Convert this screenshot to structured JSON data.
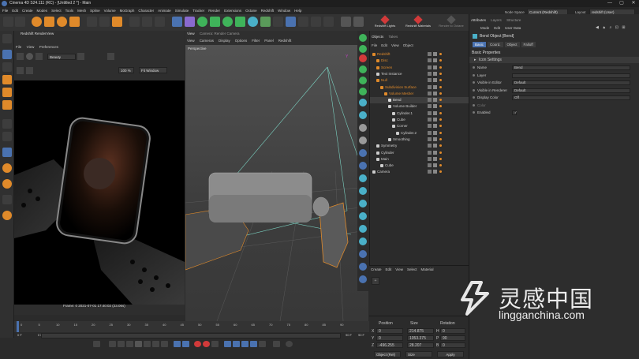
{
  "window": {
    "title": "Cinema 4D S24.111 (RC) - [Untitled 2 *] - Main",
    "controls": [
      "—",
      "▢",
      "✕"
    ]
  },
  "menubar": [
    "File",
    "Edit",
    "Create",
    "Modes",
    "Select",
    "Tools",
    "Mesh",
    "Spline",
    "Volume",
    "MoGraph",
    "Character",
    "Animate",
    "Simulate",
    "Tracker",
    "Render",
    "Extensions",
    "Octane",
    "Redshift",
    "Window",
    "Help"
  ],
  "toolbar": {
    "redshift_lights": "Redshift Lights",
    "redshift_materials": "Redshift Materials",
    "octane_label": "Render to Octane",
    "node_space_label": "Node Space",
    "node_space_value": "Current (Redshift)",
    "layout_label": "Layout",
    "layout_value": "redshift (User)"
  },
  "render_view": {
    "title": "Redshift RenderView",
    "menu": [
      "File",
      "View",
      "Preferences"
    ],
    "mode_select": "Beauty",
    "zoom": "100 %",
    "display": "Fit Window",
    "status": "Frame: 0  2021-07-01  17:40:02  (23.06s)"
  },
  "viewport": {
    "tab1": "View",
    "tab2": "Camera: Render Camera",
    "menu": [
      "View",
      "Cameras",
      "Display",
      "Options",
      "Filter",
      "Panel",
      "Redshift"
    ],
    "label": "Perspective"
  },
  "objects": {
    "tabs": [
      "Objects",
      "Takes"
    ],
    "menu": [
      "File",
      "Edit",
      "View",
      "Object"
    ],
    "items": [
      {
        "name": "Redshift",
        "indent": 0,
        "color": "#e08a2a"
      },
      {
        "name": "Disc",
        "indent": 1,
        "color": "#e08a2a"
      },
      {
        "name": "Screen",
        "indent": 1,
        "color": "#e08a2a"
      },
      {
        "name": "Text Instance",
        "indent": 1,
        "color": "#ccc"
      },
      {
        "name": "Null",
        "indent": 1,
        "color": "#e08a2a"
      },
      {
        "name": "Subdivision Surface",
        "indent": 2,
        "color": "#e08a2a"
      },
      {
        "name": "Volume Mesher",
        "indent": 3,
        "color": "#e08a2a"
      },
      {
        "name": "Bend",
        "indent": 4,
        "color": "#ddd"
      },
      {
        "name": "Volume Builder",
        "indent": 4,
        "color": "#ccc"
      },
      {
        "name": "Cylinder.1",
        "indent": 5,
        "color": "#ccc"
      },
      {
        "name": "Cube",
        "indent": 5,
        "color": "#ccc"
      },
      {
        "name": "Corner",
        "indent": 5,
        "color": "#ccc"
      },
      {
        "name": "Cylinder.2",
        "indent": 6,
        "color": "#ccc"
      },
      {
        "name": "Smoothing",
        "indent": 4,
        "color": "#ccc"
      },
      {
        "name": "Symmetry",
        "indent": 1,
        "color": "#ccc"
      },
      {
        "name": "Cylinder",
        "indent": 1,
        "color": "#ccc"
      },
      {
        "name": "Main",
        "indent": 1,
        "color": "#ccc"
      },
      {
        "name": "Cube",
        "indent": 2,
        "color": "#ccc"
      },
      {
        "name": "Camera",
        "indent": 0,
        "color": "#ccc"
      }
    ]
  },
  "materials": {
    "menu": [
      "Create",
      "Edit",
      "View",
      "Select",
      "Material"
    ]
  },
  "coords": {
    "headers": [
      "Position",
      "Size",
      "Rotation"
    ],
    "rows": [
      {
        "axis": "X",
        "pos": "0",
        "size": "214.875",
        "rotaxis": "H",
        "rot": "0"
      },
      {
        "axis": "Y",
        "pos": "0",
        "size": "1053.375",
        "rotaxis": "P",
        "rot": "90"
      },
      {
        "axis": "Z",
        "pos": "-496.255",
        "size": "28.207",
        "rotaxis": "B",
        "rot": "0"
      }
    ],
    "mode": "Object (Rel)",
    "size_mode": "Size",
    "apply": "Apply"
  },
  "attributes": {
    "tabs": [
      "Attributes",
      "Layers",
      "Structure"
    ],
    "menu": [
      "Mode",
      "Edit",
      "User Data"
    ],
    "object_title": "Bend Object [Bend]",
    "subtabs": [
      "Basic",
      "Coord.",
      "Object",
      "Falloff"
    ],
    "section": "Basic Properties",
    "subsection": "Icon Settings",
    "fields": [
      {
        "label": "Name",
        "value": "Bend"
      },
      {
        "label": "Layer",
        "value": ""
      },
      {
        "label": "Visible in Editor",
        "value": "Default"
      },
      {
        "label": "Visible in Renderer",
        "value": "Default"
      },
      {
        "label": "Display Color",
        "value": "Off"
      },
      {
        "label": "Color",
        "value": ""
      },
      {
        "label": "Enabled",
        "value": "✓"
      }
    ]
  },
  "timeline": {
    "ticks": [
      "0",
      "5",
      "10",
      "15",
      "20",
      "25",
      "30",
      "35",
      "40",
      "45",
      "50",
      "55",
      "60",
      "65",
      "70",
      "75",
      "80",
      "85",
      "90"
    ],
    "start": "0 F",
    "current": "0 F",
    "end": "90 F",
    "end2": "90 F",
    "frame_value": "0"
  },
  "watermark": {
    "cn": "灵感中国",
    "url": "lingganchina.com"
  },
  "colors": {
    "accent_orange": "#e08a2a",
    "redshift_red": "#d23a3a",
    "select_blue": "#4a72b0"
  }
}
